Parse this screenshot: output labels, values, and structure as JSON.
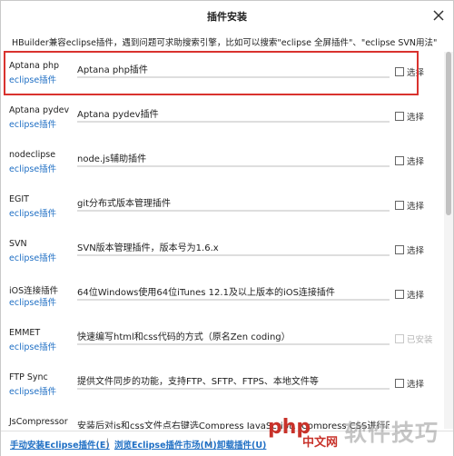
{
  "window": {
    "title": "插件安装",
    "hint": "HBuilder兼容eclipse插件，遇到问题可求助搜索引擎，比如可以搜索\"eclipse 全屏插件\"、\"eclipse SVN用法\""
  },
  "plugins": [
    {
      "name": "Aptana php",
      "type": "eclipse插件",
      "description": "Aptana php插件",
      "action": "选择",
      "installed": false
    },
    {
      "name": "Aptana pydev",
      "type": "eclipse插件",
      "description": "Aptana pydev插件",
      "action": "选择",
      "installed": false
    },
    {
      "name": "nodeclipse",
      "type": "eclipse插件",
      "description": "node.js辅助插件",
      "action": "选择",
      "installed": false
    },
    {
      "name": "EGIT",
      "type": "eclipse插件",
      "description": "git分布式版本管理插件",
      "action": "选择",
      "installed": false
    },
    {
      "name": "SVN",
      "type": "eclipse插件",
      "description": "SVN版本管理插件，版本号为1.6.x",
      "action": "选择",
      "installed": false
    },
    {
      "name": "iOS连接插件",
      "type": "eclipse插件",
      "description": "64位Windows使用64位iTunes 12.1及以上版本的iOS连接插件",
      "action": "选择",
      "installed": false
    },
    {
      "name": "EMMET",
      "type": "eclipse插件",
      "description": "快速编写html和css代码的方式（原名Zen coding）",
      "action": "已安装",
      "installed": true
    },
    {
      "name": "FTP Sync",
      "type": "eclipse插件",
      "description": "提供文件同步的功能，支持FTP、SFTP、FTPS、本地文件等",
      "action": "选择",
      "installed": false
    },
    {
      "name": "JsCompressor",
      "type": "",
      "description": "安装后对js和css文件点右键选Compress JavaScript、Compress CSS进行压缩",
      "action": "",
      "installed": false
    }
  ],
  "footer": {
    "manual_install": "手动安装Eclipse插件(E)",
    "browse_market": "浏览Eclipse插件市场(M)",
    "uninstall": "卸载插件(U)",
    "separator": "|"
  },
  "watermark": {
    "logo_text": "php",
    "logo_sub": "中文网",
    "text": "软件技巧"
  },
  "colors": {
    "link": "#1f6fc4",
    "highlight": "#d9322e"
  }
}
